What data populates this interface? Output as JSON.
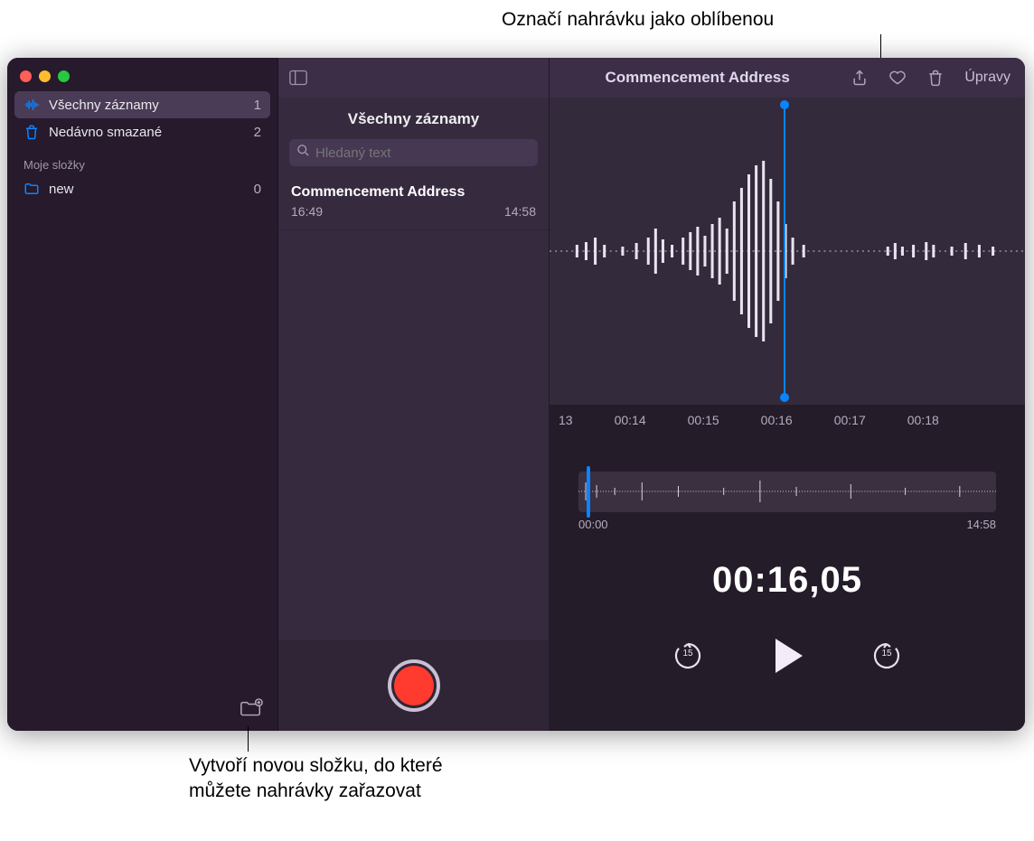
{
  "callouts": {
    "top": "Označí nahrávku jako oblíbenou",
    "bottom_line1": "Vytvoří novou složku, do které",
    "bottom_line2": "můžete nahrávky zařazovat"
  },
  "sidebar": {
    "items": [
      {
        "icon": "waveform",
        "label": "Všechny záznamy",
        "count": "1",
        "selected": true
      },
      {
        "icon": "trash",
        "label": "Nedávno smazané",
        "count": "2",
        "selected": false
      }
    ],
    "section_header": "Moje složky",
    "folders": [
      {
        "label": "new",
        "count": "0"
      }
    ]
  },
  "reclist": {
    "header": "Všechny záznamy",
    "search_placeholder": "Hledaný text",
    "recordings": [
      {
        "title": "Commencement Address",
        "time": "16:49",
        "duration": "14:58"
      }
    ]
  },
  "detail": {
    "title": "Commencement Address",
    "edit_label": "Úpravy",
    "timeline_ticks": [
      "13",
      "00:14",
      "00:15",
      "00:16",
      "00:17",
      "00:18"
    ],
    "mini_start": "00:00",
    "mini_end": "14:58",
    "current_time": "00:16,05",
    "skip_seconds": "15"
  },
  "colors": {
    "accent": "#0a84ff",
    "record": "#ff3b30"
  }
}
